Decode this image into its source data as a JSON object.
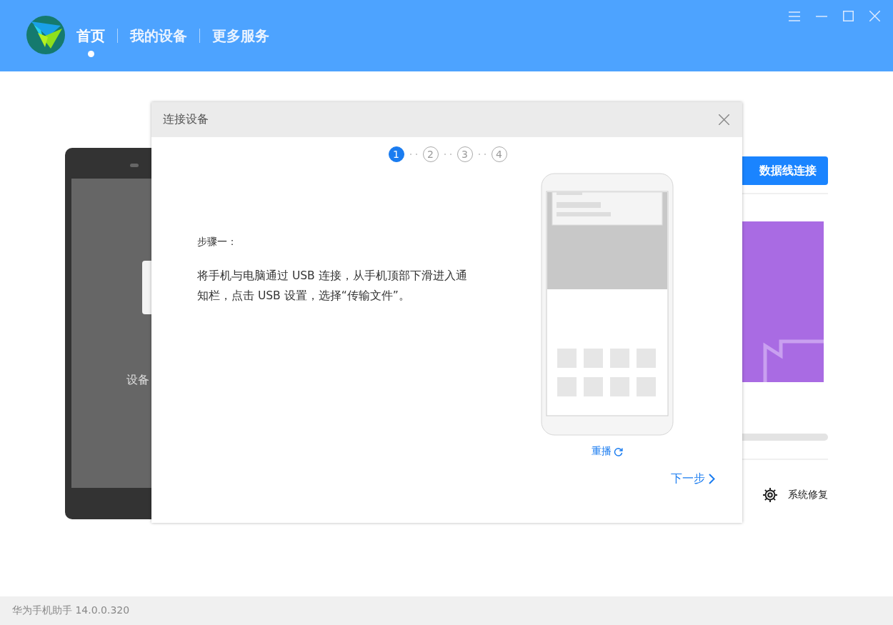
{
  "nav": [
    {
      "label": "首页",
      "selected": true
    },
    {
      "label": "我的设备",
      "selected": false
    },
    {
      "label": "更多服务",
      "selected": false
    }
  ],
  "background": {
    "device_caption": "设备",
    "connect_button": "数据线连接",
    "tool": "系统修复"
  },
  "dialog": {
    "title": "连接设备",
    "steps": [
      {
        "label": "1",
        "selected": true
      },
      {
        "label": "2",
        "selected": false
      },
      {
        "label": "3",
        "selected": false
      },
      {
        "label": "4",
        "selected": false
      }
    ],
    "step_title": "步骤一：",
    "instruction": "将手机与电脑通过 USB 连接，从手机顶部下滑进入通知栏，点击 USB 设置，选择“传输文件”。",
    "replay": "重播",
    "next": "下一步"
  },
  "status_bar": "华为手机助手 14.0.0.320"
}
